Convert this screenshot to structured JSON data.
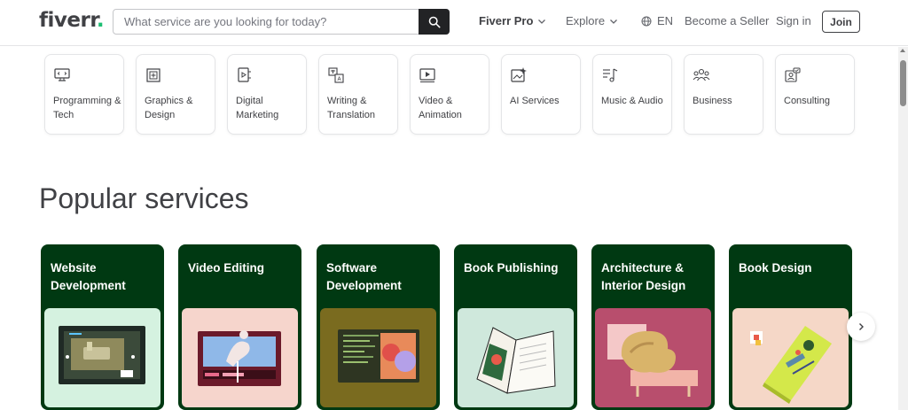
{
  "header": {
    "logo_text": "fiverr",
    "logo_dot": ".",
    "search_placeholder": "What service are you looking for today?",
    "nav": {
      "fiverr_pro": "Fiverr Pro",
      "explore": "Explore",
      "language": "EN",
      "become_seller": "Become a Seller",
      "sign_in": "Sign in",
      "join": "Join"
    }
  },
  "categories": [
    {
      "label": "Programming & Tech",
      "icon": "monitor-code-icon"
    },
    {
      "label": "Graphics & Design",
      "icon": "design-frame-icon"
    },
    {
      "label": "Digital Marketing",
      "icon": "marketing-screen-icon"
    },
    {
      "label": "Writing & Translation",
      "icon": "translate-icon"
    },
    {
      "label": "Video & Animation",
      "icon": "video-play-icon"
    },
    {
      "label": "AI Services",
      "icon": "ai-sparkle-icon"
    },
    {
      "label": "Music & Audio",
      "icon": "music-note-icon"
    },
    {
      "label": "Business",
      "icon": "people-group-icon"
    },
    {
      "label": "Consulting",
      "icon": "consulting-chat-icon"
    }
  ],
  "popular": {
    "title": "Popular services",
    "services": [
      {
        "label": "Website Development",
        "image_color": "#d5f2e0"
      },
      {
        "label": "Video Editing",
        "image_color": "#f6d5cc"
      },
      {
        "label": "Software Development",
        "image_color": "#7a6b1f"
      },
      {
        "label": "Book Publishing",
        "image_color": "#cfe8dc"
      },
      {
        "label": "Architecture & Interior Design",
        "image_color": "#b84e6d"
      },
      {
        "label": "Book Design",
        "image_color": "#f5d7c7"
      }
    ]
  },
  "colors": {
    "brand_green": "#1dbf73",
    "card_green": "#003912",
    "text_dark": "#404145"
  }
}
